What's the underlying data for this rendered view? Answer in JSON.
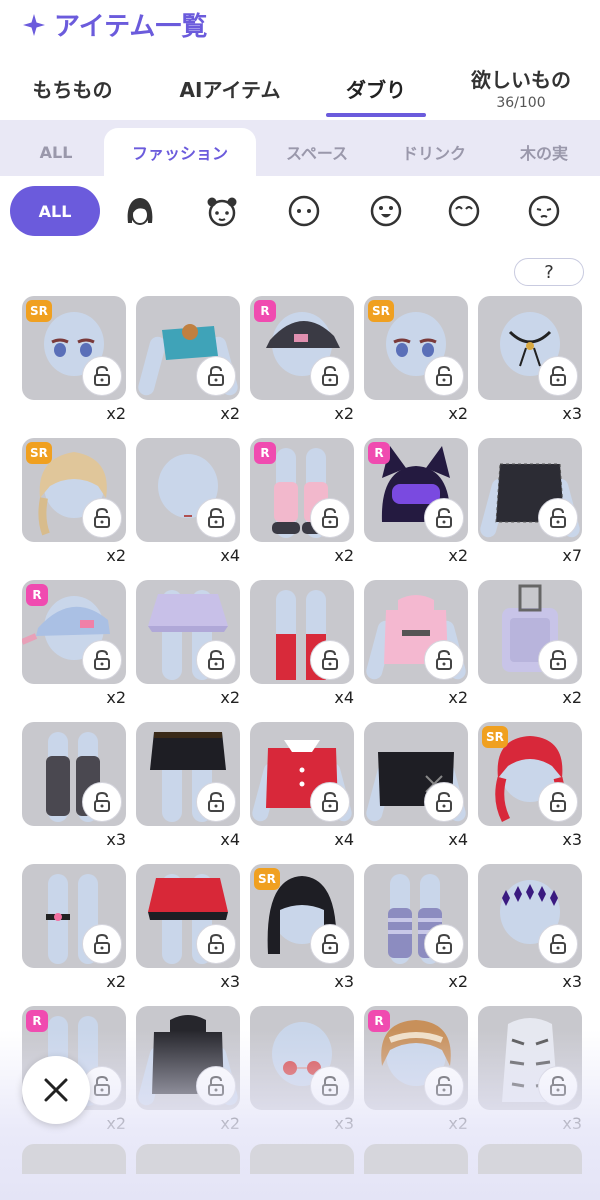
{
  "header": {
    "title": "アイテム一覧"
  },
  "tabs": [
    {
      "label": "もちもの"
    },
    {
      "label": "AIアイテム"
    },
    {
      "label": "ダブり",
      "active": true
    },
    {
      "label": "欲しいもの",
      "sub": "36/100"
    }
  ],
  "categories": [
    {
      "label": "ALL"
    },
    {
      "label": "ファッション",
      "active": true
    },
    {
      "label": "スペース"
    },
    {
      "label": "ドリンク"
    },
    {
      "label": "木の実"
    }
  ],
  "filters": {
    "all_label": "ALL",
    "icons": [
      "hair-icon",
      "animal-face-icon",
      "face-icon",
      "mouth-open-face-icon",
      "closed-eyes-face-icon",
      "sad-face-icon"
    ]
  },
  "help_label": "?",
  "colors": {
    "accent": "#6b5bdc",
    "sr_badge": "#f0a020",
    "r_badge": "#f04bb0"
  },
  "items": [
    {
      "rarity": "SR",
      "count": "x2",
      "art": "eyes"
    },
    {
      "rarity": "",
      "count": "x2",
      "art": "top-blue"
    },
    {
      "rarity": "R",
      "count": "x2",
      "art": "cap-black"
    },
    {
      "rarity": "SR",
      "count": "x2",
      "art": "eyes"
    },
    {
      "rarity": "",
      "count": "x3",
      "art": "necklace"
    },
    {
      "rarity": "SR",
      "count": "x2",
      "art": "hair-blonde"
    },
    {
      "rarity": "",
      "count": "x4",
      "art": "head"
    },
    {
      "rarity": "R",
      "count": "x2",
      "art": "boots-pink"
    },
    {
      "rarity": "R",
      "count": "x2",
      "art": "cat-helmet"
    },
    {
      "rarity": "",
      "count": "x7",
      "art": "top-lace"
    },
    {
      "rarity": "R",
      "count": "x2",
      "art": "cap-blue"
    },
    {
      "rarity": "",
      "count": "x2",
      "art": "skirt-lavender"
    },
    {
      "rarity": "",
      "count": "x4",
      "art": "socks-red"
    },
    {
      "rarity": "",
      "count": "x2",
      "art": "hoodie-pink"
    },
    {
      "rarity": "",
      "count": "x2",
      "art": "suitcase"
    },
    {
      "rarity": "",
      "count": "x3",
      "art": "socks-gray"
    },
    {
      "rarity": "",
      "count": "x4",
      "art": "skirt-black"
    },
    {
      "rarity": "",
      "count": "x4",
      "art": "jacket-red"
    },
    {
      "rarity": "",
      "count": "x4",
      "art": "top-black"
    },
    {
      "rarity": "SR",
      "count": "x3",
      "art": "hair-red"
    },
    {
      "rarity": "",
      "count": "x2",
      "art": "anklet"
    },
    {
      "rarity": "",
      "count": "x3",
      "art": "skirt-red"
    },
    {
      "rarity": "SR",
      "count": "x3",
      "art": "hair-black"
    },
    {
      "rarity": "",
      "count": "x2",
      "art": "socks-stripe"
    },
    {
      "rarity": "",
      "count": "x3",
      "art": "stars"
    },
    {
      "rarity": "R",
      "count": "x2",
      "art": "shoes-black"
    },
    {
      "rarity": "",
      "count": "x2",
      "art": "coat-black"
    },
    {
      "rarity": "",
      "count": "x3",
      "art": "glasses"
    },
    {
      "rarity": "R",
      "count": "x2",
      "art": "hair-brown"
    },
    {
      "rarity": "",
      "count": "x3",
      "art": "tiger-suit"
    }
  ]
}
